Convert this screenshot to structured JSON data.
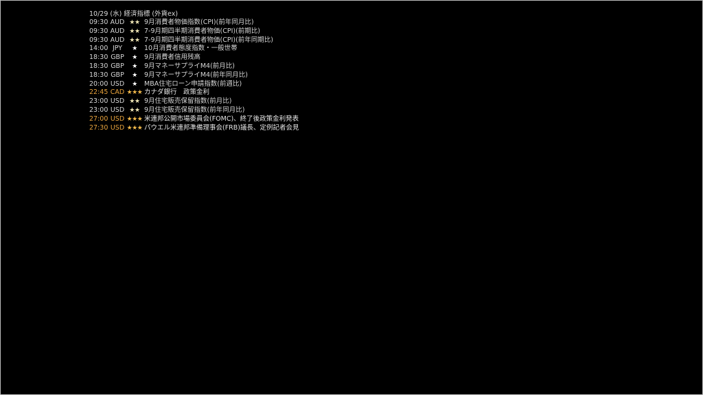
{
  "header": {
    "title": "10/29 (水) 経済指標 (外貨ex)"
  },
  "colors": {
    "normal_text": "#d6d6d6",
    "high_importance_text": "#e8a33c",
    "star_color": "#f0e6b4",
    "background": "#000000"
  },
  "events": [
    {
      "time": "09:30",
      "currency": "AUD",
      "stars": "★★",
      "name": "9月消費者物価指数(CPI)(前年同月比)",
      "level": "normal"
    },
    {
      "time": "09:30",
      "currency": "AUD",
      "stars": "★★",
      "name": "7-9月期四半期消費者物価(CPI)(前期比)",
      "level": "normal"
    },
    {
      "time": "09:30",
      "currency": "AUD",
      "stars": "★★",
      "name": "7-9月期四半期消費者物価(CPI)(前年同期比)",
      "level": "normal"
    },
    {
      "time": "14:00",
      "currency": "JPY",
      "stars": "★",
      "name": "10月消費者態度指数・一般世帯",
      "level": "normal"
    },
    {
      "time": "18:30",
      "currency": "GBP",
      "stars": "★",
      "name": "9月消費者信用残高",
      "level": "normal"
    },
    {
      "time": "18:30",
      "currency": "GBP",
      "stars": "★",
      "name": "9月マネーサプライM4(前月比)",
      "level": "normal"
    },
    {
      "time": "18:30",
      "currency": "GBP",
      "stars": "★",
      "name": "9月マネーサプライM4(前年同月比)",
      "level": "normal"
    },
    {
      "time": "20:00",
      "currency": "USD",
      "stars": "★",
      "name": "MBA住宅ローン申請指数(前週比)",
      "level": "normal"
    },
    {
      "time": "22:45",
      "currency": "CAD",
      "stars": "★★★",
      "name": "カナダ銀行　政策金利",
      "level": "high"
    },
    {
      "time": "23:00",
      "currency": "USD",
      "stars": "★★",
      "name": "9月住宅販売保留指数(前月比)",
      "level": "normal"
    },
    {
      "time": "23:00",
      "currency": "USD",
      "stars": "★★",
      "name": "9月住宅販売保留指数(前年同月比)",
      "level": "normal"
    },
    {
      "time": "27:00",
      "currency": "USD",
      "stars": "★★★",
      "name": "米連邦公開市場委員会(FOMC)、終了後政策金利発表",
      "level": "high"
    },
    {
      "time": "27:30",
      "currency": "USD",
      "stars": "★★★",
      "name": "パウエル米連邦準備理事会(FRB)議長、定例記者会見",
      "level": "high"
    }
  ]
}
